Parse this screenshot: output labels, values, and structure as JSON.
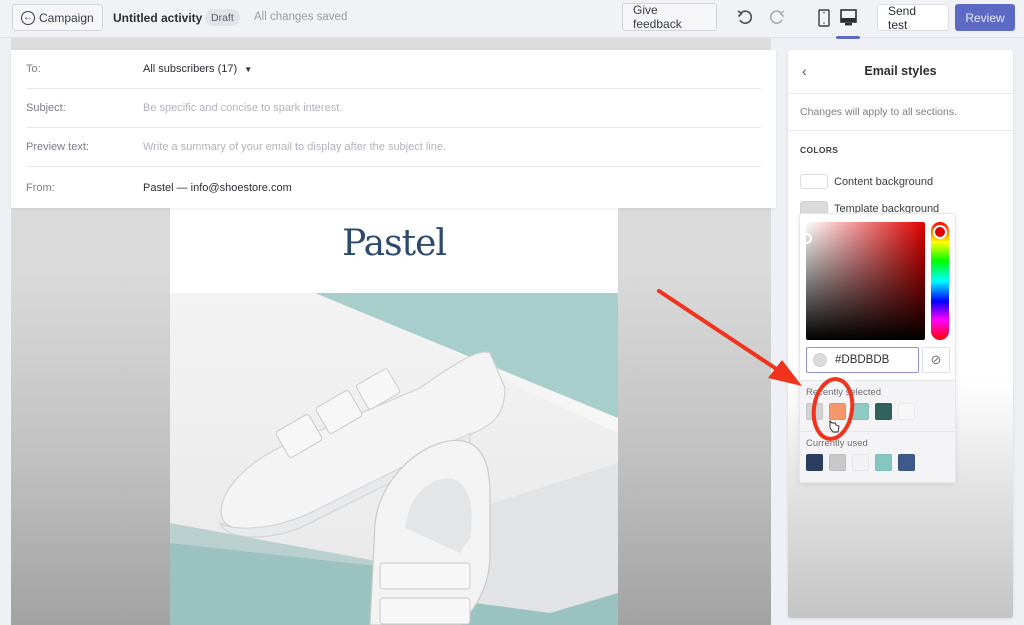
{
  "topbar": {
    "back_label": "Campaign",
    "activity_title": "Untitled activity",
    "status_badge": "Draft",
    "save_status": "All changes saved",
    "feedback_label": "Give feedback",
    "send_test_label": "Send test",
    "review_label": "Review",
    "accent_color": "#5C6AC4",
    "active_view": "desktop"
  },
  "fields": [
    {
      "label": "To:",
      "value": "All subscribers (17)",
      "placeholder": null,
      "has_dropdown": true
    },
    {
      "label": "Subject:",
      "value": "",
      "placeholder": "Be specific and concise to spark interest."
    },
    {
      "label": "Preview text:",
      "value": "",
      "placeholder": "Write a summary of your email to display after the subject line."
    },
    {
      "label": "From:",
      "value": "Pastel — info@shoestore.com",
      "placeholder": null
    }
  ],
  "email": {
    "logo_text": "Pastel",
    "logo_color": "#2C4A6E",
    "hero_alt": "White velcro sneakers on a white block against a teal background"
  },
  "panel": {
    "title": "Email styles",
    "note": "Changes will apply to all sections.",
    "section_title": "COLORS",
    "colors": [
      {
        "label": "Content background",
        "value": "#FFFFFF"
      },
      {
        "label": "Template background",
        "value": "#DBDBDB"
      }
    ]
  },
  "picker": {
    "hex_value": "#DBDBDB",
    "hue_color": "#E00000",
    "recent_label": "Recently selected",
    "recent": [
      "#D2D2D2",
      "#F4956A",
      "#8FCAC5",
      "#2F625B",
      "#F7F7F7"
    ],
    "current_label": "Currently used",
    "current": [
      "#2C3E60",
      "#C8C8C8",
      "#F2F2F2",
      "#86C6C1",
      "#3D5A8A"
    ]
  },
  "annotation": {
    "color": "#F0331D",
    "target": "recently-selected-swatch-orange"
  }
}
